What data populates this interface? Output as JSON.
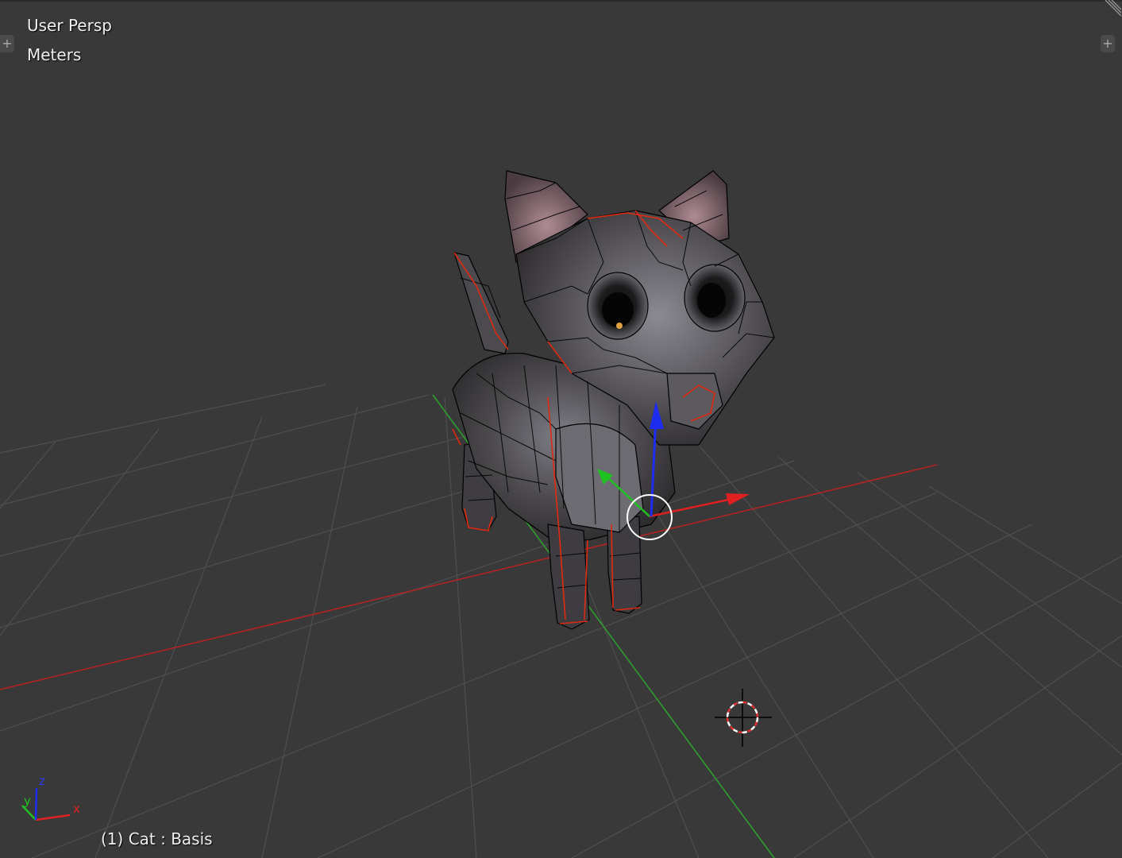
{
  "viewport": {
    "view_name": "User Persp",
    "unit_name": "Meters",
    "object_info": "(1) Cat : Basis"
  },
  "axis_gizmo": {
    "x_label": "x",
    "y_label": "y",
    "z_label": "z"
  },
  "colors": {
    "background": "#393939",
    "grid": "#4d4d4d",
    "x_axis": "#b02020",
    "y_axis": "#2f9e2f",
    "z_axis": "#1e2cf0",
    "seam": "#e02a10",
    "wire": "#000000"
  },
  "icons": {
    "left_toggle": "plus-icon",
    "right_toggle": "plus-icon",
    "corner": "area-split-grip-icon",
    "cursor": "3d-cursor-icon"
  }
}
